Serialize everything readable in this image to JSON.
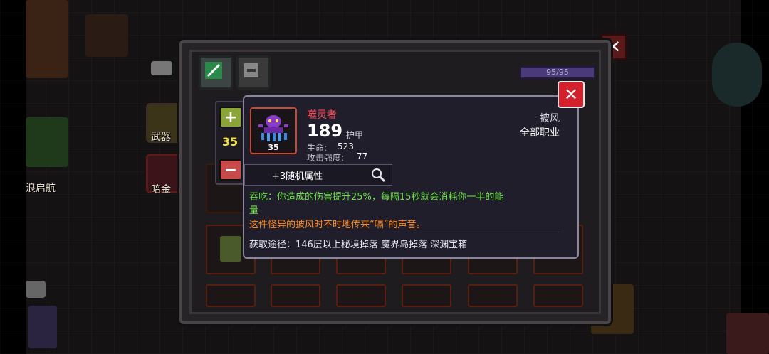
{
  "side_menu": {
    "weapons_label": "武器",
    "dark_gold_label": "暗金",
    "partial_label": "浪启航"
  },
  "panel": {
    "xp_text": "95/95"
  },
  "stepper": {
    "plus": "+",
    "quantity": "35",
    "minus": "−"
  },
  "tooltip": {
    "item_name": "噬灵者",
    "item_level": "35",
    "armor_value": "189",
    "armor_label": "护甲",
    "hp_label": "生命:",
    "hp_value": "523",
    "attack_label": "攻击强度:",
    "attack_value": "77",
    "item_type": "披风",
    "class_req": "全部职业",
    "random_attr": "+3随机属性",
    "effect_line1": "吞吃：你造成的伤害提升25%，每隔15秒就会消耗你一半的能",
    "effect_line2": "量",
    "flavor_text": "这件怪异的披风时不时地传来“嗝”的声音。",
    "source": "获取途径：146层以上秘境掉落 魔界岛掉落 深渊宝箱"
  },
  "colors": {
    "item_name": "#ff4a5a",
    "effect": "#6ee04a",
    "flavor": "#ff8a1c",
    "close_red": "#d4202a"
  },
  "icons": {
    "close": "close-icon",
    "inspect": "magnifier-icon",
    "item": "purple-squid-cape-icon"
  }
}
